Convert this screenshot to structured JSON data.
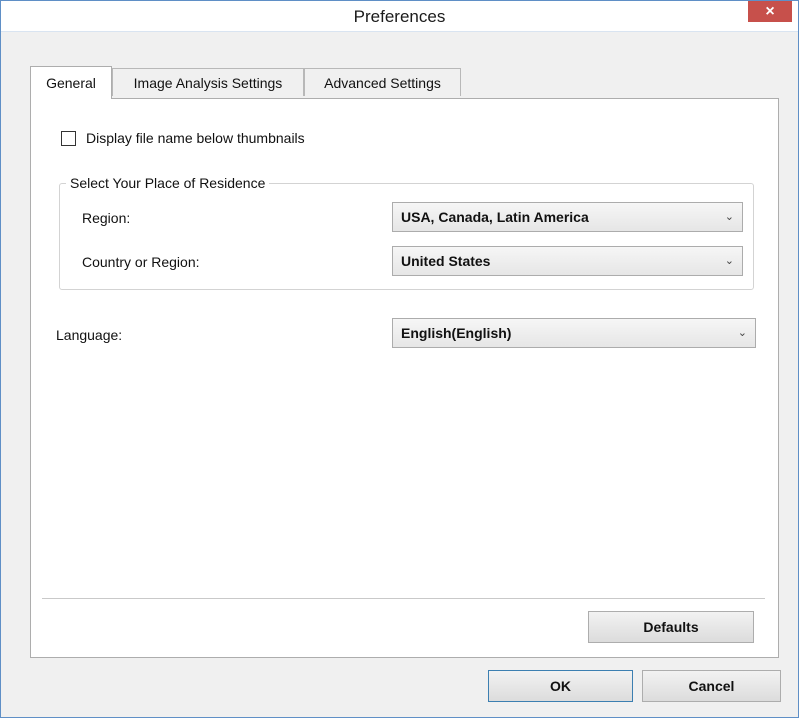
{
  "window": {
    "title": "Preferences",
    "close_glyph": "×"
  },
  "tabs": [
    {
      "label": "General",
      "active": true
    },
    {
      "label": "Image Analysis Settings",
      "active": false
    },
    {
      "label": "Advanced Settings",
      "active": false
    }
  ],
  "general": {
    "display_filename": {
      "label": "Display file name below thumbnails",
      "checked": false
    },
    "residence_group": {
      "title": "Select Your Place of Residence",
      "region_label": "Region:",
      "region_value": "USA, Canada, Latin America",
      "country_label": "Country or Region:",
      "country_value": "United States"
    },
    "language_label": "Language:",
    "language_value": "English(English)",
    "defaults_label": "Defaults"
  },
  "footer": {
    "ok_label": "OK",
    "cancel_label": "Cancel"
  },
  "icons": {
    "close": "close-icon",
    "dropdown": "chevron-down-icon"
  },
  "colors": {
    "close_button": "#c7504b",
    "window_border": "#5f8fc6"
  }
}
